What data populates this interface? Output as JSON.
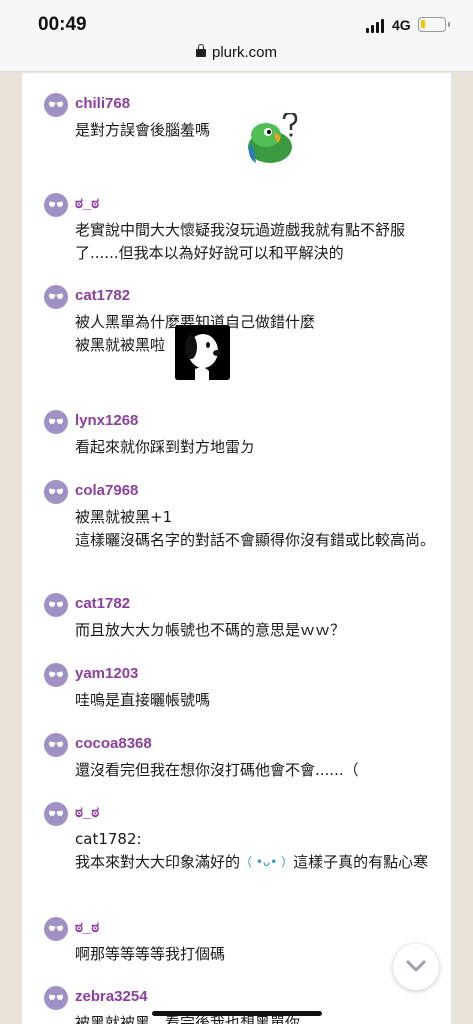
{
  "status_bar": {
    "time": "00:49",
    "network": "4G",
    "battery_level": 0.2
  },
  "browser": {
    "url": "plurk.com"
  },
  "colors": {
    "username": "#8b3fa1",
    "avatar": "#a091c4",
    "panel": "#ffffff",
    "page_background": "#e8e2d9"
  },
  "responses": [
    {
      "user": "chili768",
      "text": "是對方誤會後腦羞嗎",
      "emoticon": "parrot-question-emoticon"
    },
    {
      "user": "ಠ_ಠ",
      "text": "老實說中間大大懷疑我沒玩過遊戲我就有點不舒服了......但我本以為好好說可以和平解決的"
    },
    {
      "user": "cat1782",
      "text": "被人黑單為什麼要知道自己做錯什麼\n被黑就被黑啦",
      "emoticon": "snoopy-emoticon"
    },
    {
      "user": "lynx1268",
      "text": "看起來就你踩到對方地雷ㄉ"
    },
    {
      "user": "cola7968",
      "text": "被黑就被黑+1\n這樣曬沒碼名字的對話不會顯得你沒有錯或比較高尚。"
    },
    {
      "user": "cat1782",
      "text": "而且放大大ㄉ帳號也不碼的意思是ｗｗ？"
    },
    {
      "user": "yam1203",
      "text": "哇嗚是直接曬帳號嗎"
    },
    {
      "user": "cocoa8368",
      "text": "還沒看完但我在想你沒打碼他會不會......（"
    },
    {
      "user": "ಠ_ಠ",
      "text": "cat1782:\n我本來對大大印象滿好的",
      "kaomoji": "（ •ᴗ• ）",
      "text_after": "這樣子真的有點心寒"
    },
    {
      "user": "ಠ_ಠ",
      "text": "啊那等等等等我打個碼"
    },
    {
      "user": "zebra3254",
      "text": "被黑就被黑，看完後我也想黑單你"
    }
  ]
}
